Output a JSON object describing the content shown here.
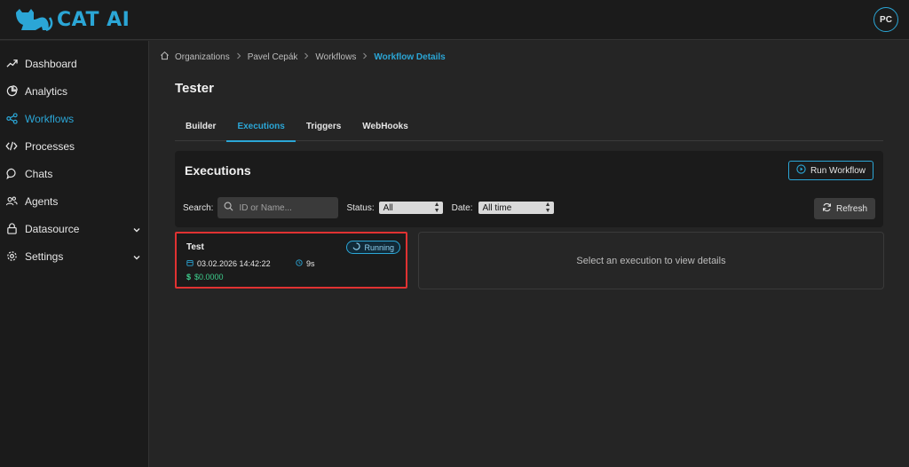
{
  "app": {
    "brand": "CAT AI",
    "avatar_initials": "PC",
    "accent": "#2ba6d6"
  },
  "sidebar": {
    "items": [
      {
        "label": "Dashboard",
        "icon": "trending-up-icon",
        "active": false
      },
      {
        "label": "Analytics",
        "icon": "pie-chart-icon",
        "active": false
      },
      {
        "label": "Workflows",
        "icon": "share-nodes-icon",
        "active": true
      },
      {
        "label": "Processes",
        "icon": "code-icon",
        "active": false
      },
      {
        "label": "Chats",
        "icon": "chat-bubble-icon",
        "active": false
      },
      {
        "label": "Agents",
        "icon": "users-icon",
        "active": false
      },
      {
        "label": "Datasource",
        "icon": "lock-icon",
        "active": false,
        "expandable": true
      },
      {
        "label": "Settings",
        "icon": "gear-icon",
        "active": false,
        "expandable": true
      }
    ]
  },
  "breadcrumb": [
    "Organizations",
    "Pavel Cepák",
    "Workflows",
    "Workflow Details"
  ],
  "page": {
    "title": "Tester"
  },
  "tabs": [
    {
      "label": "Builder",
      "active": false
    },
    {
      "label": "Executions",
      "active": true
    },
    {
      "label": "Triggers",
      "active": false
    },
    {
      "label": "WebHooks",
      "active": false
    }
  ],
  "executions": {
    "title": "Executions",
    "run_label": "Run Workflow",
    "search_label": "Search:",
    "search_placeholder": "ID or Name...",
    "status_label": "Status:",
    "status_value": "All",
    "date_label": "Date:",
    "date_value": "All time",
    "refresh_label": "Refresh"
  },
  "execution_card": {
    "name": "Test",
    "status": "Running",
    "datetime": "03.02.2026 14:42:22",
    "duration": "9s",
    "cost": "$0.0000"
  },
  "details": {
    "empty_text": "Select an execution to view details"
  }
}
